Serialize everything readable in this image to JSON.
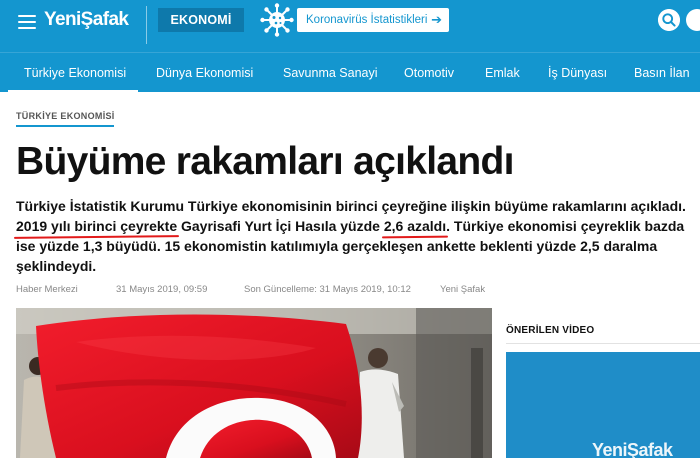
{
  "header": {
    "logo": "YeniŞafak",
    "section": "EKONOMİ",
    "covid_button": "Koronavirüs İstatistikleri",
    "covid_arrow": "➔"
  },
  "nav": {
    "items": [
      {
        "label": "Türkiye Ekonomisi"
      },
      {
        "label": "Dünya Ekonomisi"
      },
      {
        "label": "Savunma Sanayi"
      },
      {
        "label": "Otomotiv"
      },
      {
        "label": "Emlak"
      },
      {
        "label": "İş Dünyası"
      },
      {
        "label": "Basın İlan"
      }
    ]
  },
  "article": {
    "category": "TÜRKİYE EKONOMİSİ",
    "headline": "Büyüme rakamları açıklandı",
    "lead": {
      "p1": "Türkiye İstatistik Kurumu Türkiye ekonomisinin birinci çeyreğine ilişkin büyüme rakamlarını açıkladı. ",
      "mark1": "2019 yılı birinci çeyrekte",
      "p2": " Gayrisafi Yurt İçi Hasıla yüzde ",
      "mark2": "2,6 azaldı",
      "p3": ". Türkiye ekonomisi çeyreklik bazda ise yüzde 1,3 büyüdü. 15 ekonomistin katılımıyla gerçekleşen ankette beklenti yüzde 2,5 daralma şeklindeydi."
    },
    "meta": {
      "author": "Haber Merkezi",
      "published": "31 Mayıs 2019, 09:59",
      "updated": "Son Güncelleme: 31 Mayıs 2019, 10:12",
      "source": "Yeni Şafak"
    }
  },
  "sidebar": {
    "title": "ÖNERİLEN VİDEO",
    "video_logo": "YeniŞafak"
  },
  "colors": {
    "brand_blue": "#1496cf",
    "badge_blue": "#0e79ab",
    "highlight_red": "#e21a1a"
  }
}
